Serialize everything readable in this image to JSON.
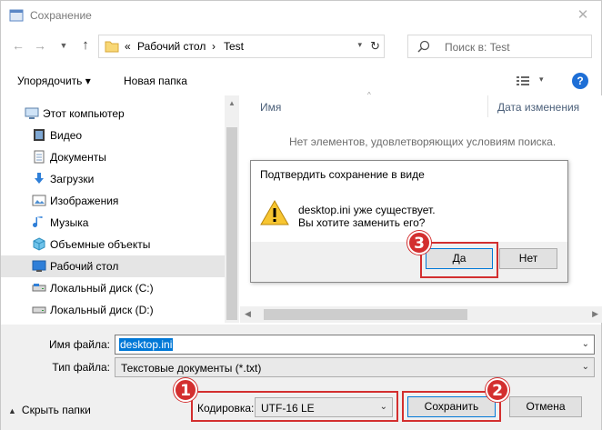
{
  "window": {
    "title": "Сохранение",
    "close_glyph": "✕"
  },
  "address": {
    "prefix": "«",
    "crumbs": [
      "Рабочий стол",
      "Test"
    ],
    "separator": "›"
  },
  "search": {
    "placeholder": "Поиск в: Test"
  },
  "toolbar": {
    "organize_label": "Упорядочить ▾",
    "new_folder_label": "Новая папка",
    "view_glyph": "▾",
    "help_glyph": "?"
  },
  "sidebar": {
    "items": [
      {
        "label": "Этот компьютер",
        "icon": "computer-icon"
      },
      {
        "label": "Видео",
        "icon": "video-icon"
      },
      {
        "label": "Документы",
        "icon": "documents-icon"
      },
      {
        "label": "Загрузки",
        "icon": "downloads-icon"
      },
      {
        "label": "Изображения",
        "icon": "pictures-icon"
      },
      {
        "label": "Музыка",
        "icon": "music-icon"
      },
      {
        "label": "Объемные объекты",
        "icon": "3d-objects-icon"
      },
      {
        "label": "Рабочий стол",
        "icon": "desktop-icon"
      },
      {
        "label": "Локальный диск (C:)",
        "icon": "drive-c-icon"
      },
      {
        "label": "Локальный диск (D:)",
        "icon": "drive-d-icon"
      }
    ],
    "selected_index": 7
  },
  "content": {
    "col_name": "Имя",
    "col_date": "Дата изменения",
    "empty_message": "Нет элементов, удовлетворяющих условиям поиска."
  },
  "form": {
    "filename_label": "Имя файла:",
    "filename_value": "desktop.ini",
    "filetype_label": "Тип файла:",
    "filetype_value": "Текстовые документы (*.txt)",
    "encoding_label": "Кодировка:",
    "encoding_value": "UTF-16 LE",
    "hide_folders_label": "Скрыть папки",
    "save_label": "Сохранить",
    "cancel_label": "Отмена"
  },
  "dialog": {
    "title": "Подтвердить сохранение в виде",
    "message_line1": "desktop.ini уже существует.",
    "message_line2": "Вы хотите заменить его?",
    "yes_label": "Да",
    "no_label": "Нет"
  },
  "badges": [
    "1",
    "2",
    "3"
  ],
  "colors": {
    "accent": "#0078d7",
    "highlight": "#d32f2f",
    "help": "#1e6fd6"
  }
}
